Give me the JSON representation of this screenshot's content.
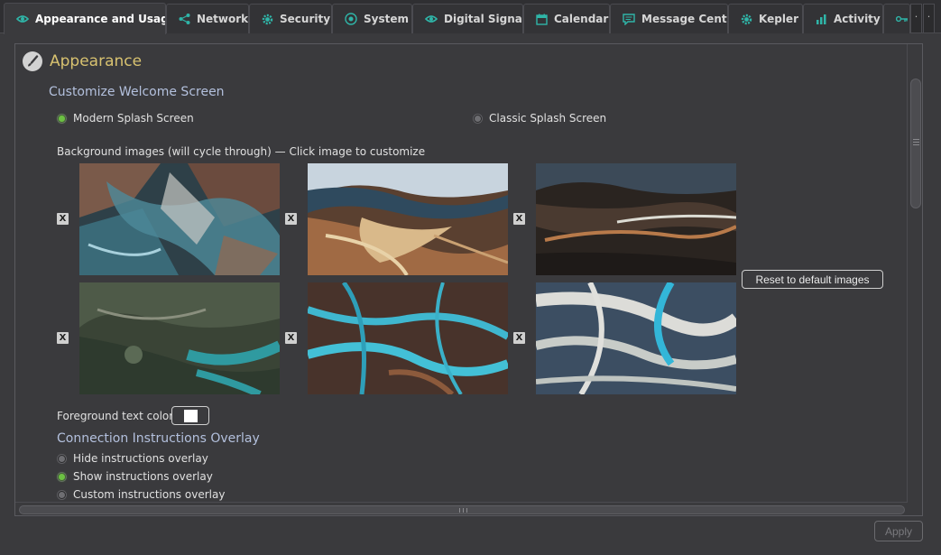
{
  "tabs": [
    {
      "label": "Appearance and Usage",
      "icon": "eye-icon",
      "active": true
    },
    {
      "label": "Network",
      "icon": "share-icon",
      "active": false
    },
    {
      "label": "Security",
      "icon": "gear-icon",
      "active": false
    },
    {
      "label": "System",
      "icon": "target-icon",
      "active": false
    },
    {
      "label": "Digital Signage",
      "icon": "eye-icon",
      "active": false
    },
    {
      "label": "Calendar",
      "icon": "calendar-icon",
      "active": false
    },
    {
      "label": "Message Center",
      "icon": "message-icon",
      "active": false
    },
    {
      "label": "Kepler",
      "icon": "gear-icon",
      "active": false
    },
    {
      "label": "Activity",
      "icon": "bar-chart-icon",
      "active": false
    },
    {
      "label": "",
      "icon": "key-icon",
      "active": false
    }
  ],
  "tab_scroll": {
    "left": "·",
    "right": "·"
  },
  "appearance": {
    "title": "Appearance",
    "customize_title": "Customize Welcome Screen",
    "splash_options": [
      {
        "label": "Modern Splash Screen",
        "selected": true
      },
      {
        "label": "Classic Splash Screen",
        "selected": false
      }
    ],
    "bg_images_label": "Background images (will cycle through) — Click image to customize",
    "remove_label": "X",
    "reset_label": "Reset to default images",
    "fg_color_label": "Foreground text color",
    "fg_color": "#ffffff",
    "overlay_title": "Connection Instructions Overlay",
    "overlay_options": [
      {
        "label": "Hide instructions overlay",
        "selected": false
      },
      {
        "label": "Show instructions overlay",
        "selected": true
      },
      {
        "label": "Custom instructions overlay",
        "selected": false
      }
    ]
  },
  "apply_label": "Apply",
  "colors": {
    "accent_teal": "#2fb5a8",
    "section_title": "#d8c270",
    "subtitle": "#b3c0dd",
    "radio_on": "#6cc043"
  }
}
